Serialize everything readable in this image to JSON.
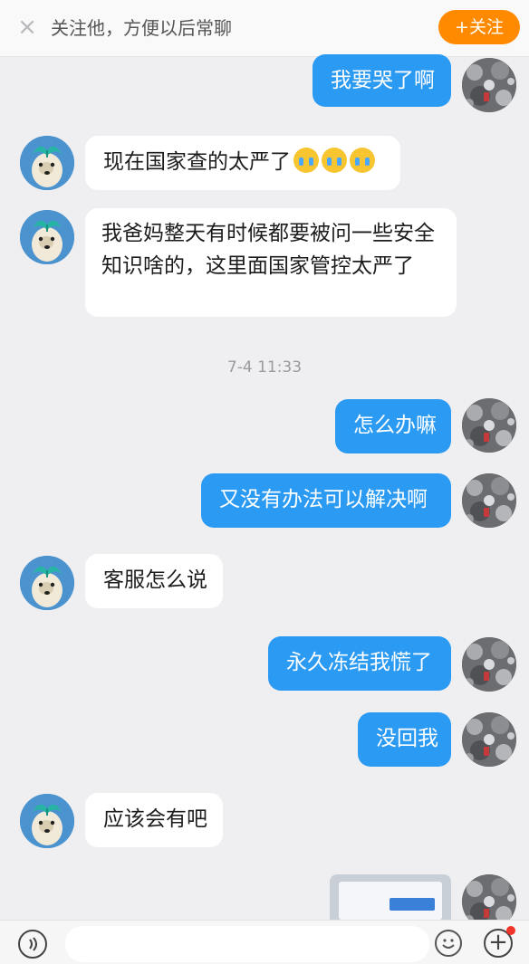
{
  "header": {
    "close_glyph": "×",
    "follow_hint": "关注他，方便以后常聊",
    "follow_button": "+关注"
  },
  "messages": [
    {
      "from": "self",
      "text": "我要哭了啊"
    },
    {
      "from": "other",
      "text": "现在国家查的太严了",
      "emoji": [
        "sob",
        "sob",
        "sob"
      ]
    },
    {
      "from": "other",
      "text": "我爸妈整天有时候都要被问一些安全知识啥的，这里面国家管控太严了"
    },
    {
      "from": "self",
      "text": "怎么办嘛"
    },
    {
      "from": "self",
      "text": "又没有办法可以解决啊"
    },
    {
      "from": "other",
      "text": "客服怎么说"
    },
    {
      "from": "self",
      "text": "永久冻结我慌了"
    },
    {
      "from": "self",
      "text": "没回我"
    },
    {
      "from": "other",
      "text": "应该会有吧"
    },
    {
      "from": "self",
      "type": "image"
    }
  ],
  "timestamp": "7-4 11:33",
  "composer": {
    "plus_glyph": "+",
    "input_value": ""
  },
  "colors": {
    "background": "#efeff1",
    "outgoing_bubble": "#2b9af3",
    "incoming_bubble": "#ffffff",
    "follow_button": "#ff8a00",
    "notification_dot": "#f0362a"
  },
  "icons": {
    "close": "close-icon",
    "voice": "voice-icon",
    "emoji": "emoji-icon",
    "more": "plus-icon",
    "crying_emoji": "crying-emoji-icon"
  }
}
